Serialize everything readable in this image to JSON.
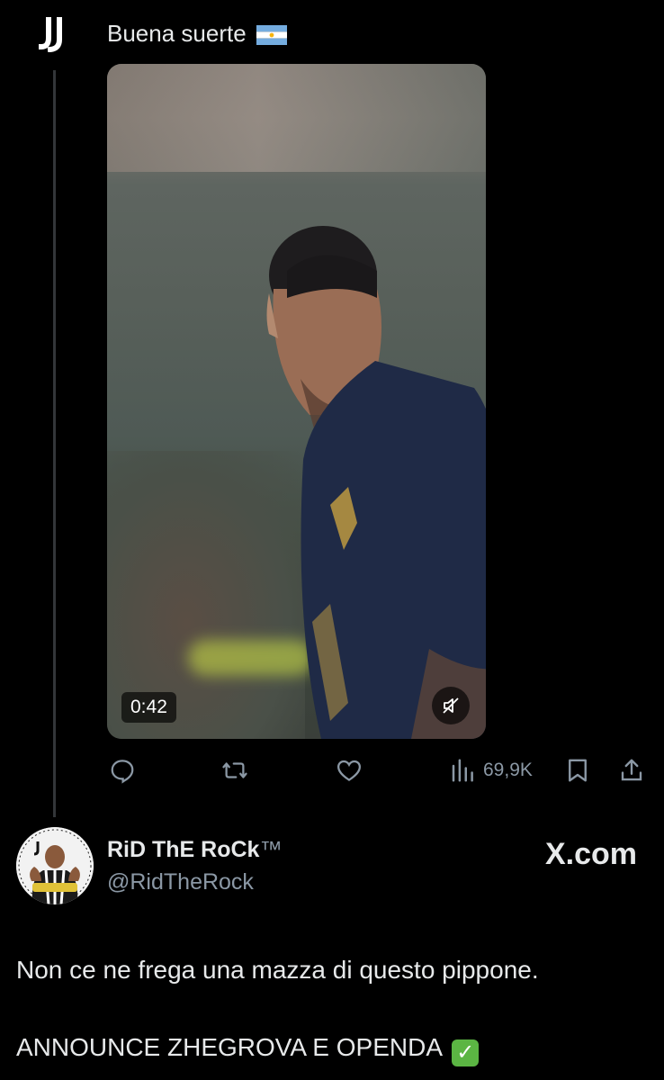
{
  "post": {
    "text": "Buena suerte",
    "flag_icon": "argentina-flag-icon",
    "video": {
      "duration": "0:42",
      "muted": true
    },
    "actions": {
      "reply_icon": "reply-icon",
      "repost_icon": "repost-icon",
      "like_icon": "heart-icon",
      "views_icon": "analytics-icon",
      "views_count": "69,9K",
      "bookmark_icon": "bookmark-icon",
      "share_icon": "share-icon"
    }
  },
  "reply": {
    "display_name": "RiD ThE RoCk",
    "trademark": "™",
    "handle": "@RidTheRock",
    "source": "X.com",
    "text_line1": "Non ce ne frega una mazza di questo pippone.",
    "text_line2": "ANNOUNCE ZHEGROVA E OPENDA"
  },
  "colors": {
    "background": "#000000",
    "text_primary": "#e7e9ea",
    "text_secondary": "#8b98a5",
    "thread_line": "#333639"
  }
}
